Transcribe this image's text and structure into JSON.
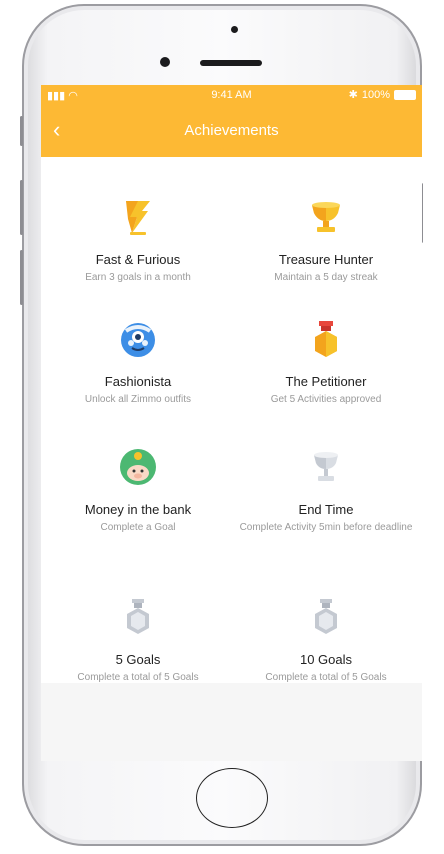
{
  "status_bar": {
    "signal": "▮▮▮ ◠",
    "time": "9:41 AM",
    "bluetooth": "✱",
    "battery": "100%"
  },
  "nav": {
    "back_icon": "‹",
    "title": "Achievements"
  },
  "colors": {
    "accent": "#fdb934"
  },
  "achievements": [
    {
      "name": "Fast & Furious",
      "desc": "Earn 3 goals in a month",
      "icon": "lightning-trophy-icon"
    },
    {
      "name": "Treasure Hunter",
      "desc": "Maintain a 5 day streak",
      "icon": "gold-cup-icon"
    },
    {
      "name": "Fashionista",
      "desc": "Unlock all Zimmo outfits",
      "icon": "zimmo-mascot-icon"
    },
    {
      "name": "The Petitioner",
      "desc": "Get 5 Activities approved",
      "icon": "medal-icon"
    },
    {
      "name": "Money in the bank",
      "desc": "Complete a Goal",
      "icon": "piggy-bank-icon"
    },
    {
      "name": "End Time",
      "desc": "Complete Activity 5min before deadline",
      "icon": "silver-cup-icon"
    },
    {
      "name": "5 Goals",
      "desc": "Complete a total of 5 Goals",
      "icon": "silver-medal-icon"
    },
    {
      "name": "10 Goals",
      "desc": "Complete a total of 5 Goals",
      "icon": "silver-medal-icon"
    }
  ]
}
